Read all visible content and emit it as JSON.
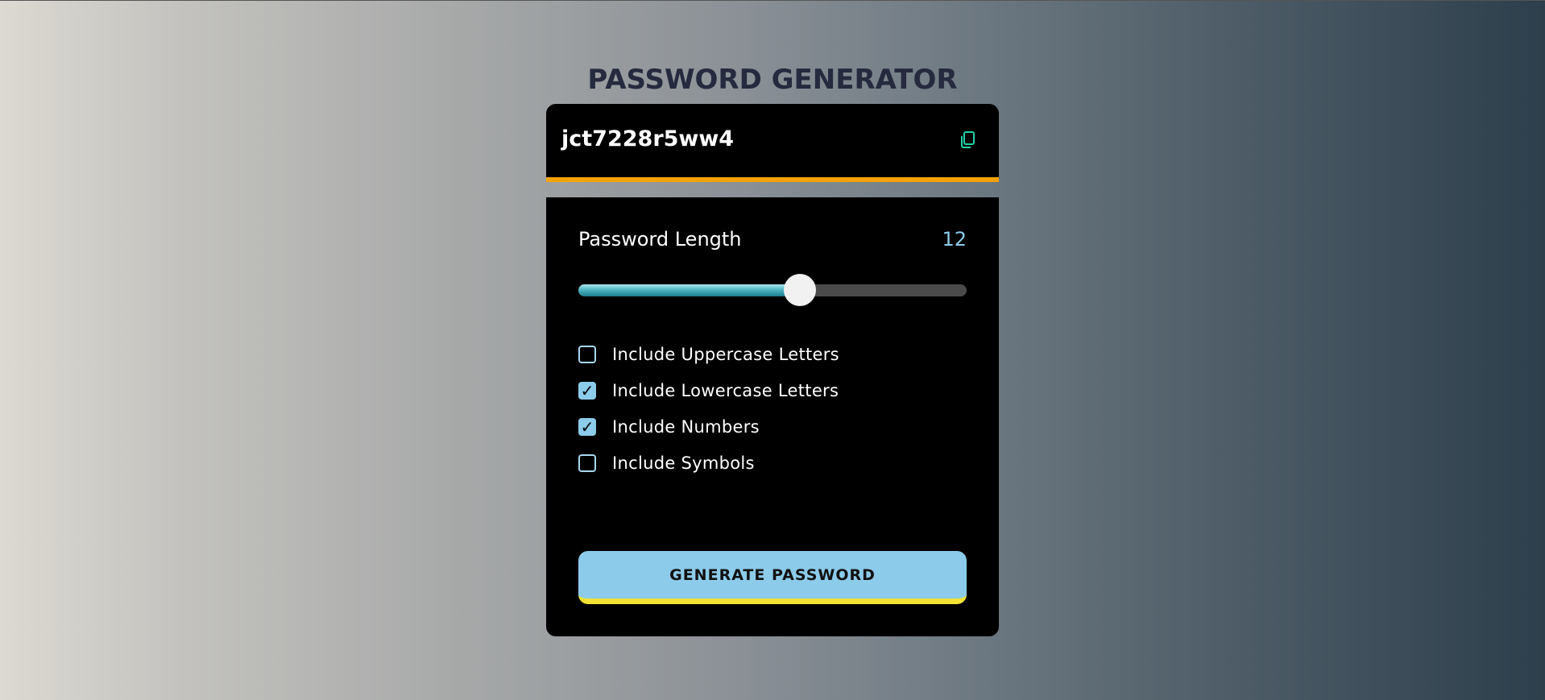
{
  "app": {
    "title": "PASSWORD GENERATOR"
  },
  "display": {
    "password": "jct7228r5ww4",
    "copy_icon": "copy-icon"
  },
  "length": {
    "label": "Password Length",
    "value": "12",
    "slider_fill_fraction": 0.57
  },
  "options": [
    {
      "label": "Include Uppercase Letters",
      "checked": false
    },
    {
      "label": "Include Lowercase Letters",
      "checked": true
    },
    {
      "label": "Include Numbers",
      "checked": true
    },
    {
      "label": "Include Symbols",
      "checked": false
    }
  ],
  "actions": {
    "generate_label": "GENERATE PASSWORD"
  },
  "colors": {
    "accent": "#8ccbea",
    "display_underline": "#f5a20a",
    "button_underline": "#f2e234",
    "copy_icon": "#1fd1a9",
    "title": "#252a3e"
  }
}
